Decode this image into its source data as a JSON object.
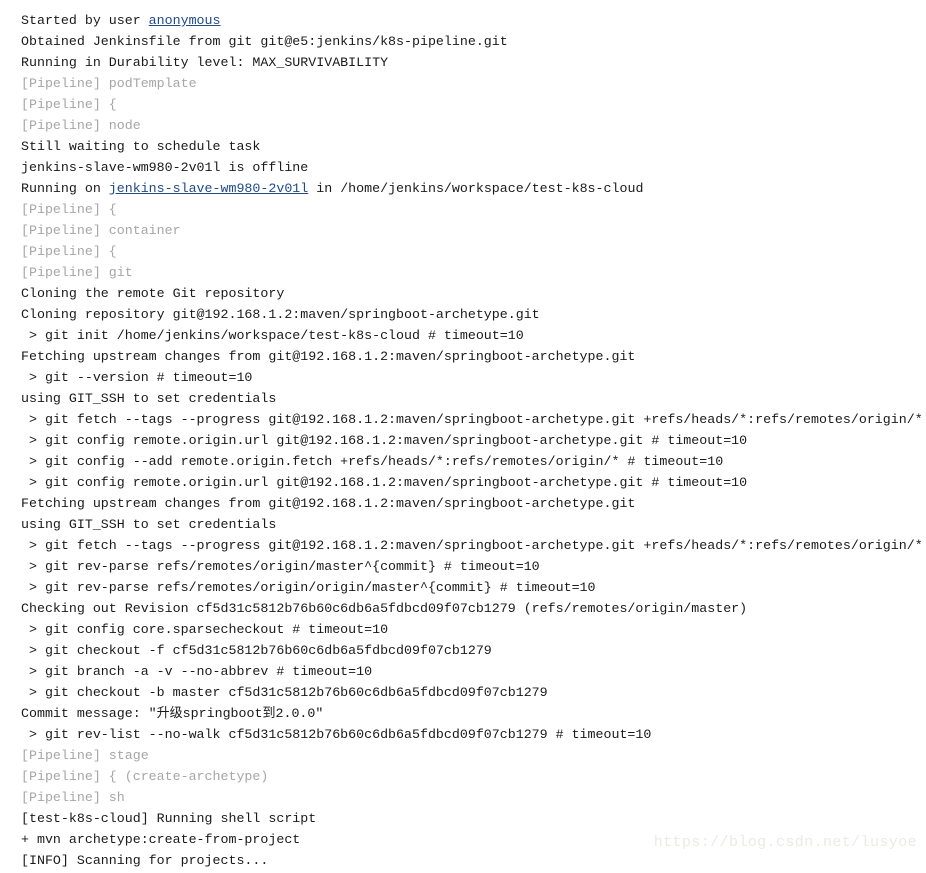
{
  "console": {
    "name": "jenkins-pipeline-console-output",
    "watermark": "https://blog.csdn.net/lusyoe",
    "link_color": "#204a87",
    "pipeline_color": "#a6a6a6",
    "text_color": "#1a1a1a",
    "background_color": "#ffffff",
    "lines": [
      {
        "id": "line-1",
        "style": "normal",
        "pre": "Started by user ",
        "link": "anonymous",
        "post": ""
      },
      {
        "id": "line-2",
        "style": "normal",
        "text": "Obtained Jenkinsfile from git git@e5:jenkins/k8s-pipeline.git"
      },
      {
        "id": "line-3",
        "style": "normal",
        "text": "Running in Durability level: MAX_SURVIVABILITY"
      },
      {
        "id": "line-4",
        "style": "pipeline",
        "text": "[Pipeline] podTemplate"
      },
      {
        "id": "line-5",
        "style": "pipeline",
        "text": "[Pipeline] {"
      },
      {
        "id": "line-6",
        "style": "pipeline",
        "text": "[Pipeline] node"
      },
      {
        "id": "line-7",
        "style": "normal",
        "text": "Still waiting to schedule task"
      },
      {
        "id": "line-8",
        "style": "normal",
        "text": "jenkins-slave-wm980-2v01l is offline"
      },
      {
        "id": "line-9",
        "style": "normal",
        "pre": "Running on ",
        "link": "jenkins-slave-wm980-2v01l",
        "post": " in /home/jenkins/workspace/test-k8s-cloud"
      },
      {
        "id": "line-10",
        "style": "pipeline",
        "text": "[Pipeline] {"
      },
      {
        "id": "line-11",
        "style": "pipeline",
        "text": "[Pipeline] container"
      },
      {
        "id": "line-12",
        "style": "pipeline",
        "text": "[Pipeline] {"
      },
      {
        "id": "line-13",
        "style": "pipeline",
        "text": "[Pipeline] git"
      },
      {
        "id": "line-14",
        "style": "normal",
        "text": "Cloning the remote Git repository"
      },
      {
        "id": "line-15",
        "style": "normal",
        "text": "Cloning repository git@192.168.1.2:maven/springboot-archetype.git"
      },
      {
        "id": "line-16",
        "style": "normal",
        "text": " > git init /home/jenkins/workspace/test-k8s-cloud # timeout=10"
      },
      {
        "id": "line-17",
        "style": "normal",
        "text": "Fetching upstream changes from git@192.168.1.2:maven/springboot-archetype.git"
      },
      {
        "id": "line-18",
        "style": "normal",
        "text": " > git --version # timeout=10"
      },
      {
        "id": "line-19",
        "style": "normal",
        "text": "using GIT_SSH to set credentials"
      },
      {
        "id": "line-20",
        "style": "normal",
        "text": " > git fetch --tags --progress git@192.168.1.2:maven/springboot-archetype.git +refs/heads/*:refs/remotes/origin/*"
      },
      {
        "id": "line-21",
        "style": "normal",
        "text": " > git config remote.origin.url git@192.168.1.2:maven/springboot-archetype.git # timeout=10"
      },
      {
        "id": "line-22",
        "style": "normal",
        "text": " > git config --add remote.origin.fetch +refs/heads/*:refs/remotes/origin/* # timeout=10"
      },
      {
        "id": "line-23",
        "style": "normal",
        "text": " > git config remote.origin.url git@192.168.1.2:maven/springboot-archetype.git # timeout=10"
      },
      {
        "id": "line-24",
        "style": "normal",
        "text": "Fetching upstream changes from git@192.168.1.2:maven/springboot-archetype.git"
      },
      {
        "id": "line-25",
        "style": "normal",
        "text": "using GIT_SSH to set credentials"
      },
      {
        "id": "line-26",
        "style": "normal",
        "text": " > git fetch --tags --progress git@192.168.1.2:maven/springboot-archetype.git +refs/heads/*:refs/remotes/origin/*"
      },
      {
        "id": "line-27",
        "style": "normal",
        "text": " > git rev-parse refs/remotes/origin/master^{commit} # timeout=10"
      },
      {
        "id": "line-28",
        "style": "normal",
        "text": " > git rev-parse refs/remotes/origin/origin/master^{commit} # timeout=10"
      },
      {
        "id": "line-29",
        "style": "normal",
        "text": "Checking out Revision cf5d31c5812b76b60c6db6a5fdbcd09f07cb1279 (refs/remotes/origin/master)"
      },
      {
        "id": "line-30",
        "style": "normal",
        "text": " > git config core.sparsecheckout # timeout=10"
      },
      {
        "id": "line-31",
        "style": "normal",
        "text": " > git checkout -f cf5d31c5812b76b60c6db6a5fdbcd09f07cb1279"
      },
      {
        "id": "line-32",
        "style": "normal",
        "text": " > git branch -a -v --no-abbrev # timeout=10"
      },
      {
        "id": "line-33",
        "style": "normal",
        "text": " > git checkout -b master cf5d31c5812b76b60c6db6a5fdbcd09f07cb1279"
      },
      {
        "id": "line-34",
        "style": "normal",
        "text": "Commit message: \"升级springboot到2.0.0\""
      },
      {
        "id": "line-35",
        "style": "normal",
        "text": " > git rev-list --no-walk cf5d31c5812b76b60c6db6a5fdbcd09f07cb1279 # timeout=10"
      },
      {
        "id": "line-36",
        "style": "pipeline",
        "text": "[Pipeline] stage"
      },
      {
        "id": "line-37",
        "style": "pipeline",
        "text": "[Pipeline] { (create-archetype)"
      },
      {
        "id": "line-38",
        "style": "pipeline",
        "text": "[Pipeline] sh"
      },
      {
        "id": "line-39",
        "style": "normal",
        "text": "[test-k8s-cloud] Running shell script"
      },
      {
        "id": "line-40",
        "style": "normal",
        "text": "+ mvn archetype:create-from-project"
      },
      {
        "id": "line-41",
        "style": "normal",
        "text": "[INFO] Scanning for projects..."
      }
    ]
  }
}
